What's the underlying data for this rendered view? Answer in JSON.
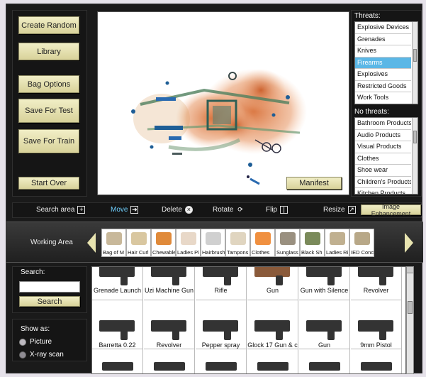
{
  "left_buttons": {
    "create_random": "Create Random",
    "library": "Library",
    "bag_options": "Bag Options",
    "save_for_test": "Save For Test",
    "save_for_train": "Save For Train",
    "start_over": "Start Over"
  },
  "manifest_label": "Manifest",
  "threats": {
    "header": "Threats:",
    "items": [
      "Explosive Devices",
      "Grenades",
      "Knives",
      "Firearms",
      "Explosives",
      "Restricted Goods",
      "Work Tools"
    ],
    "selected": "Firearms"
  },
  "no_threats": {
    "header": "No threats:",
    "items": [
      "Bathroom Products",
      "Audio Products",
      "Visual Products",
      "Clothes",
      "Shoe wear",
      "Children's Products",
      "Kitchen Products"
    ]
  },
  "toolbar": {
    "search_area": "Search area",
    "move": "Move",
    "delete": "Delete",
    "rotate": "Rotate",
    "flip": "Flip",
    "resize": "Resize",
    "image_enhancement": "Image Enhancement"
  },
  "working_area": {
    "label": "Working Area",
    "items": [
      "Bag of M",
      "Hair Curl",
      "Chewable",
      "Ladies Pi",
      "Hairbrush",
      "Tampons",
      "Clothes",
      "Sunglass",
      "Black Sh",
      "Ladies Ri",
      "IED Conc"
    ]
  },
  "search": {
    "label": "Search:",
    "value": "",
    "button": "Search"
  },
  "show_as": {
    "label": "Show as:",
    "options": [
      "Picture",
      "X-ray scan"
    ],
    "selected": "Picture"
  },
  "library_items": {
    "row1": [
      "Grenade Launch",
      "Uzi Machine Gun",
      "Rifle",
      "Gun",
      "Gun with Silence",
      "Revolver"
    ],
    "row2": [
      "Barretta 0.22",
      "Revolver",
      "Pepper spray",
      "Glock 17 Gun & c",
      "Gun",
      "9mm Pistol"
    ]
  },
  "colors": {
    "button_bg": "#e6e1aa",
    "selected_item": "#5bb7e6",
    "move_active": "#6fd0ff"
  }
}
